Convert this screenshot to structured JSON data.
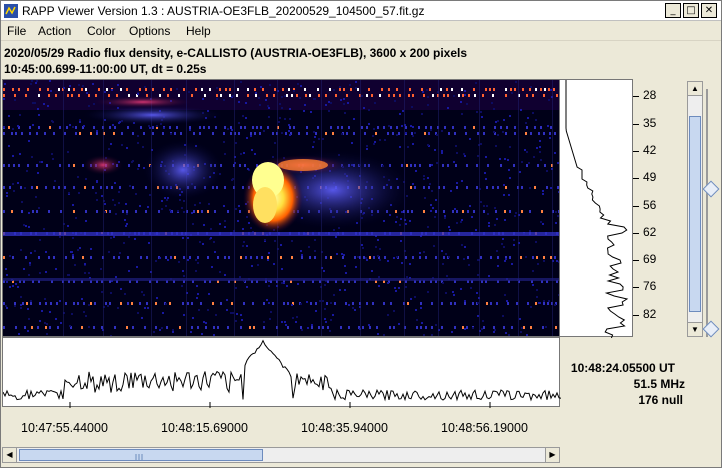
{
  "window": {
    "title": "RAPP Viewer Version 1.3 : AUSTRIA-OE3FLB_20200529_104500_57.fit.gz",
    "minimize_glyph": "_",
    "maximize_glyph": "□",
    "close_glyph": "✕"
  },
  "menu": {
    "items": [
      "File",
      "Action",
      "Color",
      "Options",
      "Help"
    ]
  },
  "info": {
    "line1": "2020/05/29  Radio flux density, e-CALLISTO (AUSTRIA-OE3FLB),  3600 x 200 pixels",
    "line2": "10:45:00.699-11:00:00 UT,  dt = 0.25s"
  },
  "frequency_axis": {
    "unit": "MHz",
    "ticks": [
      "28",
      "35",
      "42",
      "49",
      "56",
      "62",
      "69",
      "76",
      "82"
    ]
  },
  "time_axis": {
    "labels": [
      "10:47:55.44000",
      "10:48:15.69000",
      "10:48:35.94000",
      "10:48:56.19000"
    ]
  },
  "readout": {
    "time": "10:48:24.05500 UT",
    "frequency": "51.5 MHz",
    "value": "176 null"
  },
  "colors": {
    "background": "#ece9d8",
    "spectrogram_bg": "#00001a",
    "burst_hot": "#ffff60",
    "burst_warm": "#ff6000",
    "noise_blue": "#2020c0"
  },
  "icons": {
    "app": "rapp-app-icon",
    "up": "arrow-up-icon",
    "down": "arrow-down-icon",
    "left": "arrow-left-icon",
    "right": "arrow-right-icon"
  }
}
